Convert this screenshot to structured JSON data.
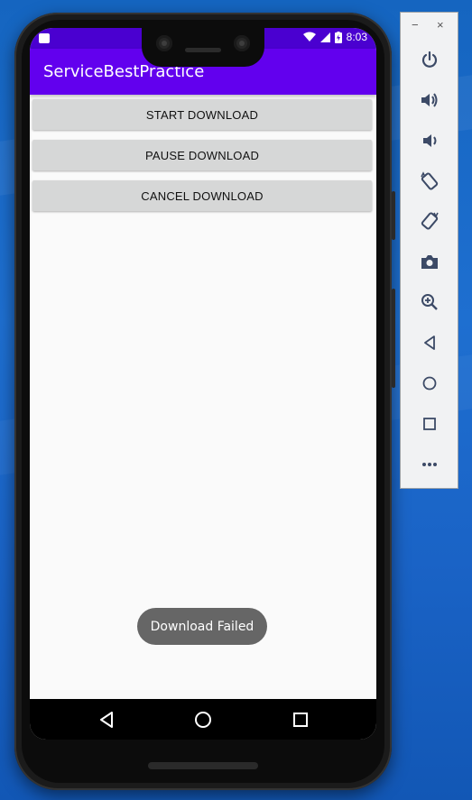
{
  "app": {
    "title": "ServiceBestPractice"
  },
  "status_bar": {
    "time": "8:03",
    "icons": [
      "notification-icon",
      "wifi-icon",
      "signal-icon",
      "battery-charging-icon"
    ]
  },
  "buttons": [
    {
      "label": "START DOWNLOAD"
    },
    {
      "label": "PAUSE DOWNLOAD"
    },
    {
      "label": "CANCEL DOWNLOAD"
    }
  ],
  "toast": {
    "text": "Download Failed"
  },
  "nav_bar": {
    "items": [
      "back-icon",
      "home-icon",
      "recents-icon"
    ]
  },
  "emulator_panel": {
    "window_controls": {
      "minimize": "−",
      "close": "×"
    },
    "tools": [
      "power-icon",
      "volume-up-icon",
      "volume-down-icon",
      "rotate-left-icon",
      "rotate-right-icon",
      "camera-icon",
      "zoom-icon",
      "back-icon",
      "home-icon",
      "overview-icon",
      "more-icon"
    ]
  },
  "colors": {
    "app_bar": "#6200ee",
    "status_bar": "#4a00d0",
    "button": "#d6d7d7",
    "toast": "#666666",
    "desktop": "#1565c0"
  }
}
